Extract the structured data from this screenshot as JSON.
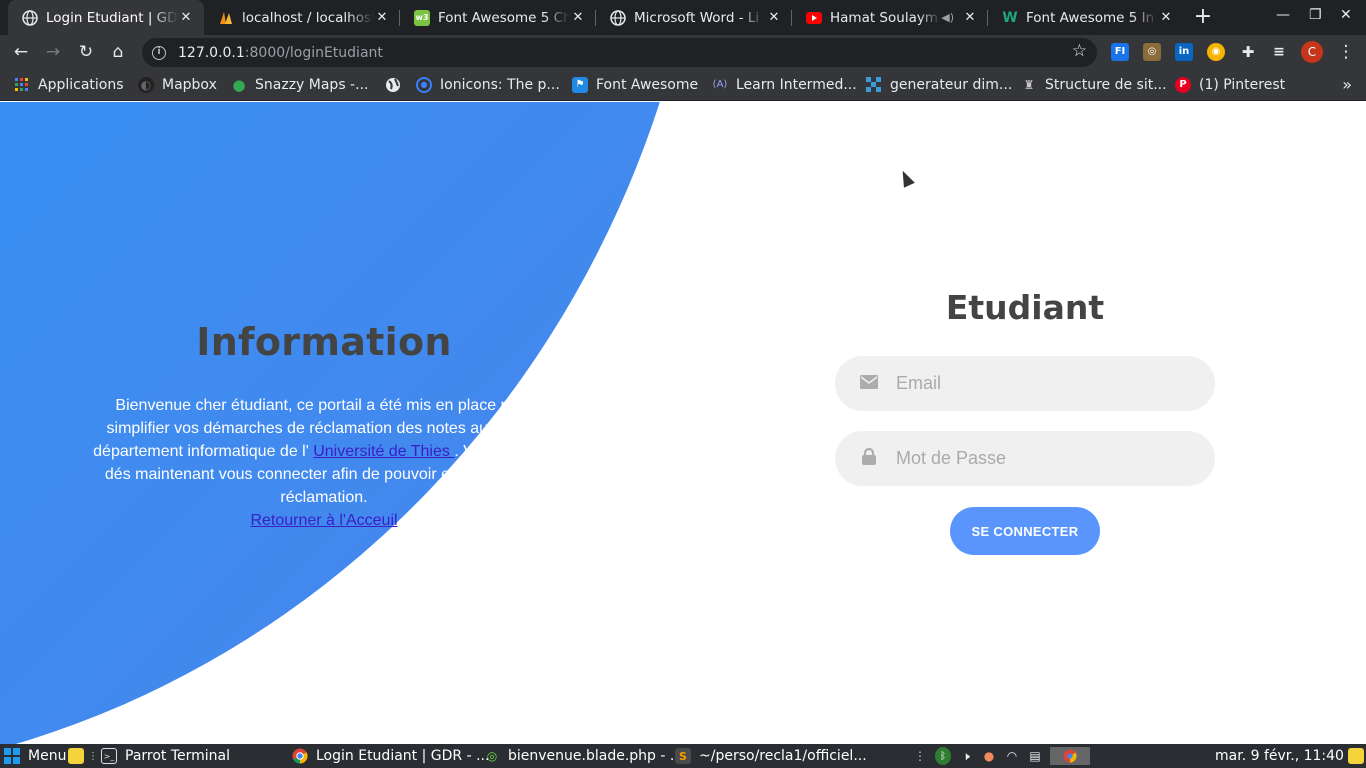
{
  "browser": {
    "tabs": [
      {
        "title": "Login Etudiant | GDR",
        "icon": "globe-icon",
        "active": true
      },
      {
        "title": "localhost / localhost",
        "icon": "phpmyadmin-icon",
        "active": false
      },
      {
        "title": "Font Awesome 5 Ch",
        "icon": "font-awesome-cheatsheet-icon",
        "active": false
      },
      {
        "title": "Microsoft Word - Li",
        "icon": "globe-icon",
        "active": false
      },
      {
        "title": "Hamat Soulaym",
        "icon": "youtube-icon",
        "active": false
      },
      {
        "title": "Font Awesome 5 In",
        "icon": "w-icon",
        "active": false
      }
    ],
    "close_glyph": "✕",
    "new_tab_glyph": "+",
    "address": {
      "host": "127.0.0.1",
      "rest": ":8000/loginEtudiant"
    },
    "profile_initial": "C",
    "bookmarks": [
      {
        "label": "Applications",
        "icon": "apps-grid-icon"
      },
      {
        "label": "Mapbox",
        "icon": "mapbox-icon"
      },
      {
        "label": "Snazzy Maps -...",
        "icon": "map-pin-icon"
      },
      {
        "label": "",
        "icon": "globe-icon"
      },
      {
        "label": "Ionicons: The p...",
        "icon": "ionicons-icon"
      },
      {
        "label": "Font Awesome",
        "icon": "flag-icon"
      },
      {
        "label": "Learn Intermed...",
        "icon": "learn-icon"
      },
      {
        "label": "generateur dim...",
        "icon": "grid-icon"
      },
      {
        "label": "Structure de sit...",
        "icon": "structure-icon"
      },
      {
        "label": "(1) Pinterest",
        "icon": "pinterest-icon"
      }
    ]
  },
  "page": {
    "info": {
      "title": "Information",
      "text_before_link": "Bienvenue cher étudiant, ce portail a été mis en place pour simplifier vos démarches de réclamation des notes auprès du département informatique de l' ",
      "link_text": "Université de Thies ",
      "text_after_link": ". Vous pouvez dés maintenant vous connecter afin de pouvoir effectuer votre réclamation.",
      "back_link": "Retourner à l'Acceuil"
    },
    "login": {
      "title": "Etudiant",
      "email_placeholder": "Email",
      "password_placeholder": "Mot de Passe",
      "submit_label": "SE CONNECTER"
    }
  },
  "taskbar": {
    "menu_label": "Menu",
    "items": [
      {
        "label": "Parrot Terminal",
        "icon": "terminal-icon"
      },
      {
        "label": "Login Etudiant | GDR - ...",
        "icon": "chrome-icon"
      },
      {
        "label": "bienvenue.blade.php - ...",
        "icon": "editor-icon"
      },
      {
        "label": "~/perso/recla1/officiel...",
        "icon": "sublime-icon"
      }
    ],
    "clock": "mar. 9 févr., 11:40"
  },
  "colors": {
    "primary_blue": "#2e96f5",
    "button_blue": "#5995fd",
    "title_gray": "#444444",
    "link_purple": "#3a1ec8"
  }
}
